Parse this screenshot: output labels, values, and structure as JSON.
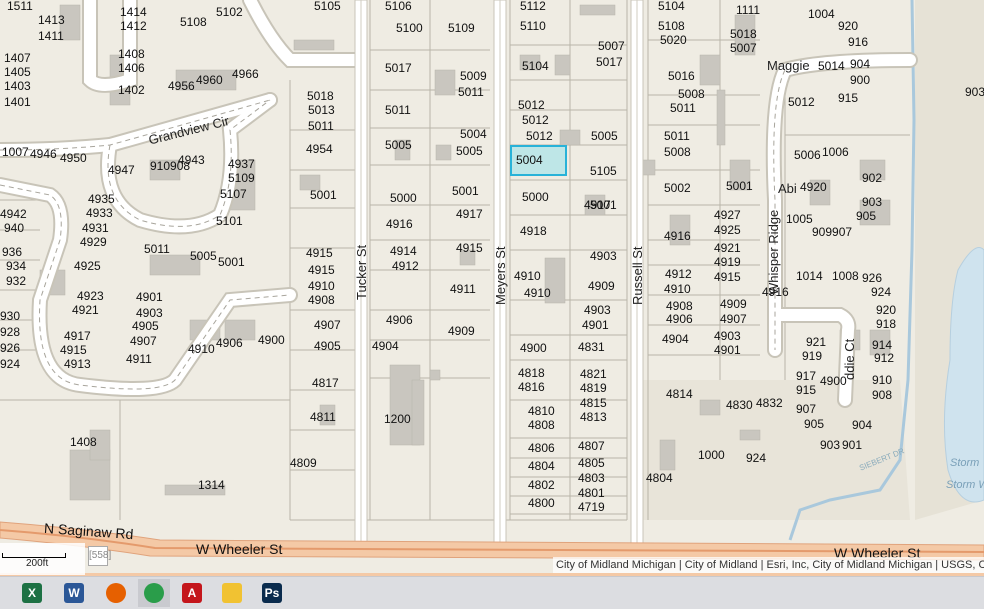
{
  "map": {
    "streets": {
      "tucker": "Tucker St",
      "meyers": "Meyers St",
      "russell": "Russell St",
      "grandview": "Grandview Cir",
      "whisper_ridge": "Whisper Ridge",
      "maggie": "Maggie",
      "abi": "Abi",
      "addie": "ddie Ct",
      "n_saginaw": "N Saginaw Rd",
      "w_wheeler_1": "W Wheeler St",
      "w_wheeler_2": "W Wheeler St",
      "siebert": "SIEBERT DR"
    },
    "water_labels": [
      "Storm",
      "Storm W"
    ],
    "selected_parcel": "5004",
    "parcels": [
      "1511",
      "1413",
      "1411",
      "1414",
      "1412",
      "5108",
      "5102",
      "5105",
      "5106",
      "5112",
      "5104",
      "1111",
      "1004",
      "920",
      "916",
      "904",
      "900",
      "915",
      "903",
      "1407",
      "1405",
      "1403",
      "1401",
      "1408",
      "1406",
      "1402",
      "4956",
      "4960",
      "4966",
      "5100",
      "5109",
      "5110",
      "5108",
      "5020",
      "5018",
      "5007",
      "5007",
      "5017",
      "5017",
      "5104",
      "5016",
      "5014",
      "5018",
      "5013",
      "5011",
      "5009",
      "5011",
      "5011",
      "5008",
      "5012",
      "5012",
      "5012",
      "5011",
      "5012",
      "1007",
      "4946",
      "4950",
      "4954",
      "5005",
      "5004",
      "5005",
      "5005",
      "5011",
      "5008",
      "5006",
      "1006",
      "910908",
      "4943",
      "4947",
      "4937",
      "5109",
      "5107",
      "5105",
      "5001",
      "5001",
      "5002",
      "5001",
      "4920",
      "902",
      "4935",
      "4933",
      "4931",
      "4929",
      "4942",
      "940",
      "936",
      "934",
      "932",
      "5001",
      "5000",
      "5000",
      "4917",
      "4917",
      "4927",
      "4925",
      "1005",
      "909907",
      "903",
      "905",
      "5101",
      "4916",
      "4918",
      "4916",
      "5011",
      "5005",
      "5001",
      "4925",
      "4915",
      "4915",
      "4914",
      "4912",
      "4915",
      "4903",
      "4912",
      "4910",
      "4921",
      "4919",
      "4915",
      "1014",
      "1008",
      "926",
      "924",
      "4916",
      "4923",
      "4921",
      "4901",
      "4903",
      "4905",
      "4907",
      "4911",
      "4910",
      "4908",
      "4911",
      "4910",
      "4910",
      "4909",
      "4908",
      "4906",
      "4909",
      "4907",
      "920",
      "918",
      "930",
      "928",
      "926",
      "924",
      "4917",
      "4915",
      "4913",
      "4910",
      "4906",
      "4900",
      "4907",
      "4905",
      "4906",
      "4904",
      "4909",
      "4903",
      "4901",
      "4904",
      "4903",
      "4901",
      "921",
      "919",
      "914",
      "912",
      "4900",
      "4831",
      "4817",
      "4818",
      "4816",
      "4821",
      "4819",
      "917",
      "915",
      "4900",
      "910",
      "908",
      "4814",
      "4830",
      "4832",
      "4811",
      "1200",
      "4810",
      "4808",
      "4815",
      "4813",
      "907",
      "905",
      "904",
      "903",
      "901",
      "1408",
      "4806",
      "4807",
      "4804",
      "4805",
      "4803",
      "1000",
      "924",
      "4809",
      "4802",
      "4801",
      "4804",
      "1314",
      "4800",
      "4719"
    ]
  },
  "attribution": "City of Midland Michigan | City of Midland | Esri, Inc, City of Midland Michigan | USGS, City Of",
  "scale": {
    "label": "200ft"
  },
  "minimize_label": "[558]",
  "taskbar": {
    "apps": [
      {
        "name": "Excel",
        "glyph": "X",
        "color": "#1d7144"
      },
      {
        "name": "Word",
        "glyph": "W",
        "color": "#2b5797"
      },
      {
        "name": "Firefox",
        "glyph": "",
        "color": "#e66000"
      },
      {
        "name": "Chrome",
        "glyph": "",
        "color": "#2a9d4a"
      },
      {
        "name": "Acrobat",
        "glyph": "A",
        "color": "#c4161c"
      },
      {
        "name": "File Explorer",
        "glyph": "",
        "color": "#f1c232"
      },
      {
        "name": "Photoshop",
        "glyph": "Ps",
        "color": "#0a2b4d"
      }
    ]
  }
}
